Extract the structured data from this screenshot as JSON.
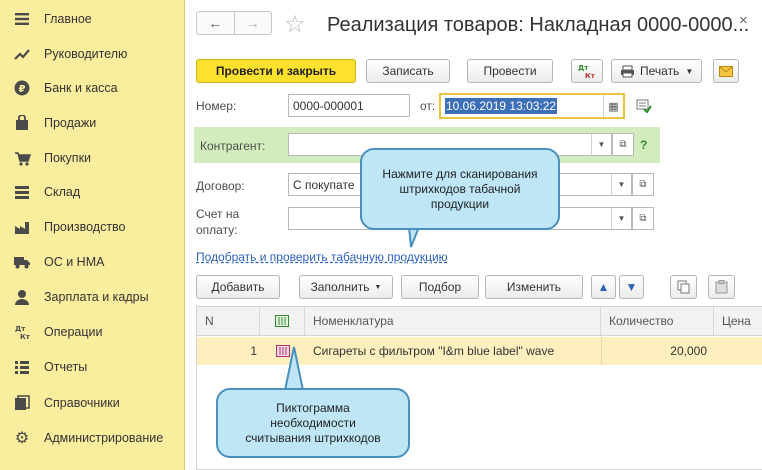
{
  "sidebar": {
    "items": [
      {
        "label": "Главное",
        "icon": "menu-icon"
      },
      {
        "label": "Руководителю",
        "icon": "trend-icon"
      },
      {
        "label": "Банк и касса",
        "icon": "ruble-icon"
      },
      {
        "label": "Продажи",
        "icon": "bag-icon"
      },
      {
        "label": "Покупки",
        "icon": "cart-icon"
      },
      {
        "label": "Склад",
        "icon": "warehouse-icon"
      },
      {
        "label": "Производство",
        "icon": "factory-icon"
      },
      {
        "label": "ОС и НМА",
        "icon": "truck-icon"
      },
      {
        "label": "Зарплата и кадры",
        "icon": "person-icon"
      },
      {
        "label": "Операции",
        "icon": "dt-kt-icon"
      },
      {
        "label": "Отчеты",
        "icon": "chart-icon"
      },
      {
        "label": "Справочники",
        "icon": "books-icon"
      },
      {
        "label": "Администрирование",
        "icon": "gear-icon"
      }
    ]
  },
  "header": {
    "back": "←",
    "forward": "→",
    "title": "Реализация товаров: Накладная 0000-0000...",
    "close": "×"
  },
  "toolbar": {
    "post_close": "Провести и закрыть",
    "save": "Записать",
    "post": "Провести",
    "dtkt": "Дт Кт",
    "print": "Печать"
  },
  "form": {
    "number_label": "Номер:",
    "number_value": "0000-000001",
    "date_label": "от:",
    "date_value": "10.06.2019 13:03:22",
    "counterparty_label": "Контрагент:",
    "counterparty_value": "",
    "contract_label": "Договор:",
    "contract_value": "С покупате",
    "invoice_label_1": "Счет на",
    "invoice_label_2": "оплату:",
    "invoice_value": ""
  },
  "link": "Подобрать и проверить табачную продукцию",
  "table_toolbar": {
    "add": "Добавить",
    "fill": "Заполнить",
    "select": "Подбор",
    "change": "Изменить"
  },
  "table": {
    "columns": [
      "N",
      "",
      "Номенклатура",
      "Количество",
      "Цена"
    ],
    "rows": [
      {
        "n": "1",
        "name": "Сигареты с фильтром \"I&m blue label\" wave",
        "qty": "20,000",
        "price": ""
      }
    ]
  },
  "callouts": {
    "scan_1": "Нажмите для сканирования",
    "scan_2": "штрихкодов табачной",
    "scan_3": "продукции",
    "icon_1": "Пиктограмма",
    "icon_2": "необходимости",
    "icon_3": "считывания штрихкодов"
  },
  "colors": {
    "sidebar_bg": "#fbed9e",
    "primary_btn": "#fde12d",
    "selection": "#3d6fb8",
    "row_highlight": "#fdf0be",
    "green_band": "#d3ecbd",
    "callout": "#bfe6f7"
  }
}
